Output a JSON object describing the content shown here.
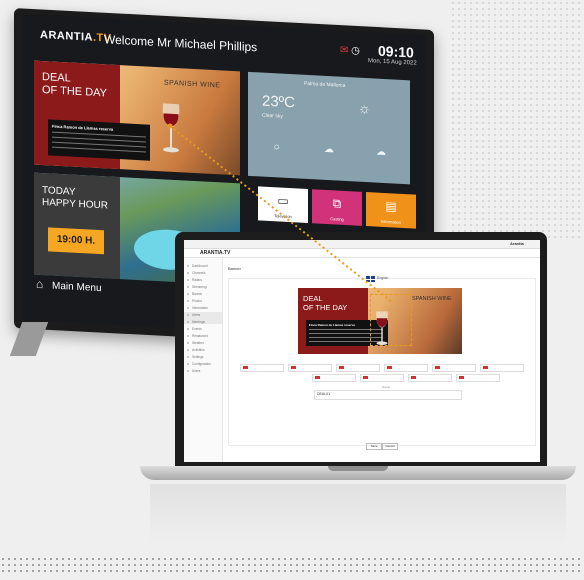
{
  "tv": {
    "brand": "ARANTIA",
    "brand_suffix": ".TV",
    "welcome": "Welcome Mr Michael Phillips",
    "time": "09:10",
    "date": "Mon, 15 Aug 2022",
    "deal_title_1": "DEAL",
    "deal_title_2": "OF THE DAY",
    "deal_product": "SPANISH WINE",
    "deal_caption": "Finca Ramon de Llamas reserva",
    "weather_temp": "23ºC",
    "weather_location": "Palma de Mallorca",
    "weather_condition": "Clear sky",
    "happy_title_1": "TODAY",
    "happy_title_2": "HAPPY HOUR",
    "happy_time": "19:00 H.",
    "tiles": [
      {
        "label": "Television",
        "icon": "tv-icon",
        "color": "#ffffff"
      },
      {
        "label": "Casting",
        "icon": "cast-icon",
        "color": "#d2327a"
      },
      {
        "label": "Information",
        "icon": "book-icon",
        "color": "#f0921a"
      }
    ],
    "main_menu": "Main Menu"
  },
  "laptop": {
    "app_title": "ARANTIA.TV",
    "top_right": "Arantia",
    "page_title": "Banner",
    "language": "English",
    "deal_title_1": "DEAL",
    "deal_title_2": "OF THE DAY",
    "deal_product": "SPANISH WINE",
    "deal_caption": "Finca Ramon de Llamas reserva",
    "field_label": "Name",
    "field_value": "DEAL01",
    "save_button": "Save",
    "cancel_button": "Cancel",
    "sidebar_items": [
      "Dashboard",
      "Channels",
      "Radios",
      "Streaming",
      "Banner",
      "Photos",
      "Information",
      "Alerts",
      "Meetings",
      "Events",
      "Restaurant",
      "Weather",
      "Activities",
      "Settings",
      "Configuration",
      "Users"
    ]
  },
  "colors": {
    "accent": "#f0a020",
    "deal_red": "#8c1a1a",
    "happy_orange": "#f5a623",
    "dotted_line": "#e89a1a"
  }
}
